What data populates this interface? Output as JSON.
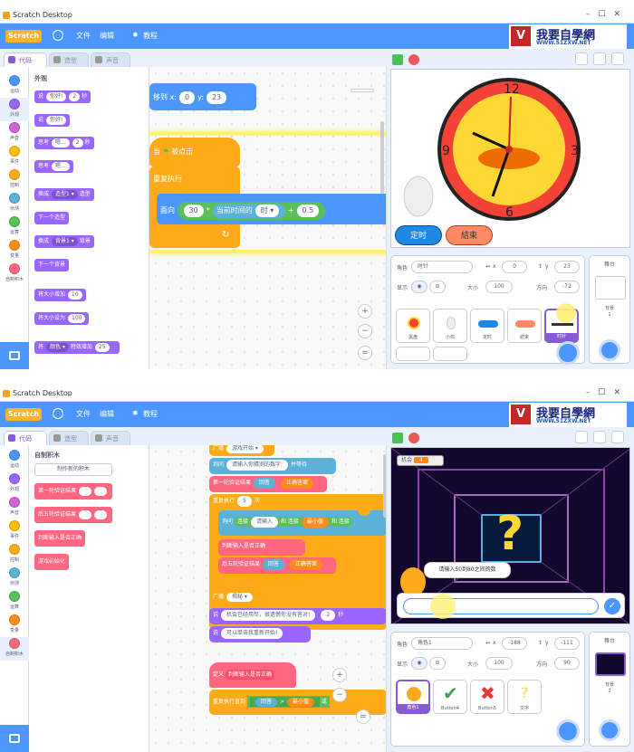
{
  "app": {
    "title": "Scratch Desktop",
    "logo_text": "Scratch"
  },
  "menu": {
    "file": "文件",
    "edit": "编辑",
    "tutorials": "教程"
  },
  "brand": {
    "title": "我要自學網",
    "url": "WWW.51ZXW.NET"
  },
  "tabs": {
    "code": "代码",
    "costumes": "造型",
    "sounds": "声音"
  },
  "categories": [
    {
      "label": "运动",
      "color": "#4c97ff"
    },
    {
      "label": "外观",
      "color": "#9966ff"
    },
    {
      "label": "声音",
      "color": "#cf63cf"
    },
    {
      "label": "事件",
      "color": "#ffbf00"
    },
    {
      "label": "控制",
      "color": "#ffab19"
    },
    {
      "label": "侦测",
      "color": "#5cb1d6"
    },
    {
      "label": "运算",
      "color": "#59c059"
    },
    {
      "label": "变量",
      "color": "#ff8c1a"
    },
    {
      "label": "自制积木",
      "color": "#ff6680"
    }
  ],
  "top": {
    "palette_header": "外观",
    "palette_blocks": [
      {
        "label": "说",
        "v1": "你好!",
        "v2": "2",
        "suffix": "秒"
      },
      {
        "label": "说",
        "v1": "你好!"
      },
      {
        "label": "思考",
        "v1": "嗯...",
        "v2": "2",
        "suffix": "秒"
      },
      {
        "label": "思考",
        "v1": "嗯..."
      },
      {
        "label": "换成",
        "v1": "造型1 ▾",
        "suffix": "造型"
      },
      {
        "label": "下一个造型"
      },
      {
        "label": "换成",
        "v1": "背景1 ▾",
        "suffix": "背景"
      },
      {
        "label": "下一个背景"
      },
      {
        "label": "将大小增加",
        "v1": "10"
      },
      {
        "label": "将大小设为",
        "v1": "100"
      },
      {
        "label": "将",
        "v1": "颜色 ▾",
        "suffix": "特效增加",
        "v2": "25"
      }
    ],
    "script": {
      "goto": "移到 x:",
      "x": "0",
      "y_label": "y:",
      "y": "23",
      "hat": "当",
      "hat_suffix": "被点击",
      "forever": "重复执行",
      "point": "面向",
      "v30": "30",
      "times": "*",
      "current": "当前时间的",
      "hour": "时 ▾",
      "plus": "+",
      "v05": "0.5"
    },
    "stage": {
      "clock_nums": [
        "12",
        "3",
        "6",
        "9"
      ],
      "btn_start": "定时",
      "btn_end": "結束"
    },
    "sprite": {
      "role_label": "角色",
      "role": "时针",
      "x_label": "x",
      "x": "0",
      "y_label": "y",
      "y": "23",
      "show_label": "显示",
      "size_label": "大小",
      "size": "100",
      "dir_label": "方向",
      "dir": "-72",
      "thumbs": [
        "黑盘",
        "小鸡",
        "定时",
        "結束",
        "时针"
      ]
    },
    "stage_panel": {
      "title": "舞台",
      "bg_label": "背景",
      "bg_count": "1"
    }
  },
  "bottom": {
    "palette_header": "自制积木",
    "make_block": "制作新的积木",
    "palette_blocks": [
      "第一轮验证结果",
      "后五轮验证结果",
      "判断输入是否正确",
      "游戏初始化"
    ],
    "script": {
      "broadcast1": "广播",
      "msg1": "游戏开始 ▾",
      "ask": "询问",
      "ask_text": "请输入你猜测的数字:",
      "ask_wait": "并等待",
      "first": "第一轮验证结果",
      "answer": "回答",
      "correct": "正确答案",
      "repeat": "重复执行",
      "repeat_n": "5",
      "repeat_unit": "次",
      "ask2": "询问",
      "join": "连接",
      "please": "请输入",
      "and": "和",
      "join2": "连接",
      "min": "最小值",
      "and2": "和",
      "join3": "连接",
      "judge": "判断输入是否正确",
      "rest": "后五轮验证结果",
      "answer2": "回答",
      "correct2": "正确答案",
      "broadcast2": "广播",
      "msg2": "揭秘 ▾",
      "say": "说",
      "say_text": "机会已经用尽，很遗憾你没有答对!",
      "say_n": "2",
      "say_unit": "秒",
      "say2": "说",
      "say2_text": "可以单击我重新开始!",
      "define": "定义",
      "define_name": "判断输入是否正确",
      "until": "重复执行直到",
      "answer3": "回答",
      "gt": ">",
      "min2": "最小值",
      "or": "或"
    },
    "stage": {
      "chance_label": "机会",
      "chance": "4",
      "bubble": "请输入50到80之间的数",
      "qmark": "?"
    },
    "sprite": {
      "role_label": "角色",
      "role": "角色1",
      "x_label": "x",
      "x": "-188",
      "y_label": "y",
      "y": "-111",
      "show_label": "显示",
      "size_label": "大小",
      "size": "100",
      "dir_label": "方向",
      "dir": "90",
      "thumbs": [
        "角色1",
        "Button4",
        "Button5",
        "文字"
      ]
    },
    "stage_panel": {
      "title": "舞台",
      "bg_label": "背景",
      "bg_count": "2"
    }
  }
}
